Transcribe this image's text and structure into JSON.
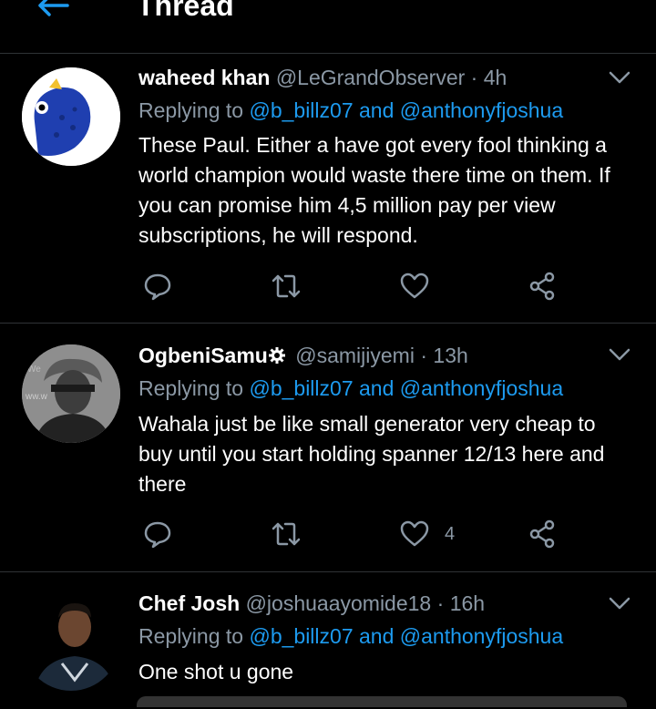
{
  "header": {
    "title": "Thread"
  },
  "tweets": [
    {
      "name": "waheed khan",
      "handle": "@LeGrandObserver",
      "dot": "·",
      "time": "4h",
      "replying_prefix": "Replying to",
      "replying_user1": "@b_billz07",
      "replying_and": "and",
      "replying_user2": "@anthonyfjoshua",
      "text": "These Paul. Either a have got every fool thinking a world champion would waste there time on them. If you can promise him 4,5 million pay per view subscriptions, he will respond.",
      "likes": ""
    },
    {
      "name": "OgbeniSamu",
      "handle": "@samijiyemi",
      "dot": "·",
      "time": "13h",
      "replying_prefix": "Replying to",
      "replying_user1": "@b_billz07",
      "replying_and": "and",
      "replying_user2": "@anthonyfjoshua",
      "text": "Wahala just be like small generator very cheap to buy until you start holding spanner 12/13 here and there",
      "likes": "4"
    },
    {
      "name": "Chef Josh",
      "handle": "@joshuaayomide18",
      "dot": "·",
      "time": "16h",
      "replying_prefix": "Replying to",
      "replying_user1": "@b_billz07",
      "replying_and": "and",
      "replying_user2": "@anthonyfjoshua",
      "text": "One shot u gone",
      "likes": ""
    }
  ],
  "colors": {
    "background": "#000000",
    "accent": "#1d9bf0",
    "muted": "#8b98a5",
    "divider": "#2f3336"
  },
  "icons": [
    "back-arrow-icon",
    "chevron-down-icon",
    "reply-icon",
    "retweet-icon",
    "like-icon",
    "share-icon",
    "gear-badge-icon"
  ]
}
